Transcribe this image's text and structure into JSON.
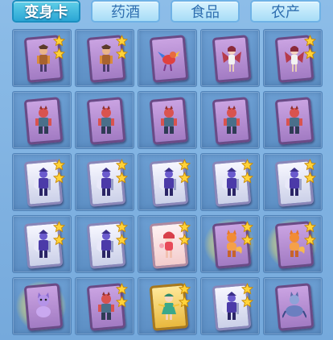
{
  "tabs": [
    {
      "label": "变身卡",
      "active": true
    },
    {
      "label": "药酒",
      "active": false
    },
    {
      "label": "食品",
      "active": false
    },
    {
      "label": "农产",
      "active": false
    }
  ],
  "colors": {
    "star": "#ffd23a",
    "star_outline": "#c98a00"
  },
  "inventory": {
    "rows": [
      [
        {
          "frame": "purple",
          "figure": "warrior-tan",
          "stars": 2,
          "glow": false
        },
        {
          "frame": "purple",
          "figure": "warrior-tan",
          "stars": 2,
          "glow": false
        },
        {
          "frame": "purple",
          "figure": "bird-red",
          "stars": 0,
          "glow": false
        },
        {
          "frame": "purple",
          "figure": "winged-girl",
          "stars": 0,
          "glow": false
        },
        {
          "frame": "purple",
          "figure": "winged-girl",
          "stars": 2,
          "glow": false
        }
      ],
      [
        {
          "frame": "purple",
          "figure": "beast-red",
          "stars": 0,
          "glow": false
        },
        {
          "frame": "purple",
          "figure": "beast-red",
          "stars": 0,
          "glow": false
        },
        {
          "frame": "purple",
          "figure": "beast-red",
          "stars": 0,
          "glow": false
        },
        {
          "frame": "purple",
          "figure": "beast-red",
          "stars": 0,
          "glow": false
        },
        {
          "frame": "purple",
          "figure": "beast-red",
          "stars": 0,
          "glow": false
        }
      ],
      [
        {
          "frame": "silver",
          "figure": "knight-purple",
          "stars": 2,
          "glow": false
        },
        {
          "frame": "silver",
          "figure": "knight-purple",
          "stars": 2,
          "glow": false
        },
        {
          "frame": "silver",
          "figure": "knight-purple",
          "stars": 2,
          "glow": false
        },
        {
          "frame": "silver",
          "figure": "knight-purple",
          "stars": 2,
          "glow": false
        },
        {
          "frame": "silver",
          "figure": "knight-purple",
          "stars": 2,
          "glow": false
        }
      ],
      [
        {
          "frame": "silver",
          "figure": "knight-purple",
          "stars": 2,
          "glow": false
        },
        {
          "frame": "silver",
          "figure": "knight-purple",
          "stars": 2,
          "glow": false
        },
        {
          "frame": "pink",
          "figure": "doll-red",
          "stars": 2,
          "glow": false
        },
        {
          "frame": "purple",
          "figure": "fox-orange",
          "stars": 2,
          "glow": true
        },
        {
          "frame": "purple",
          "figure": "fox-orange",
          "stars": 2,
          "glow": true
        }
      ],
      [
        {
          "frame": "purple",
          "figure": "cat-pink",
          "stars": 0,
          "glow": true
        },
        {
          "frame": "purple",
          "figure": "beast-red",
          "stars": 2,
          "glow": false
        },
        {
          "frame": "gold",
          "figure": "dancer-green",
          "stars": 2,
          "glow": false
        },
        {
          "frame": "silver",
          "figure": "knight-purple",
          "stars": 2,
          "glow": false
        },
        {
          "frame": "purple",
          "figure": "wolf-blue",
          "stars": 0,
          "glow": false
        }
      ]
    ]
  }
}
